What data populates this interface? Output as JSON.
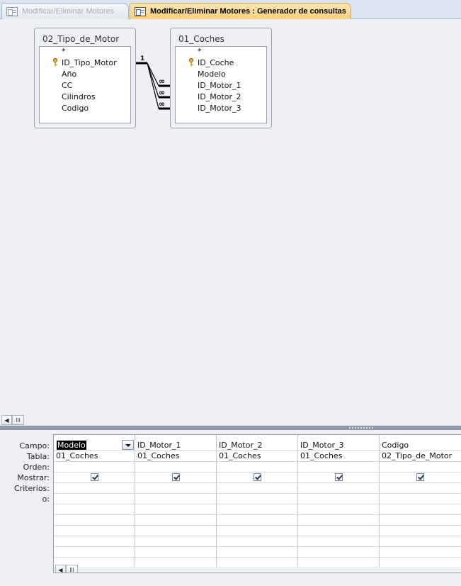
{
  "tabs": [
    {
      "label": "Modificar/Eliminar Motores",
      "state": "inactive"
    },
    {
      "label": "Modificar/Eliminar Motores : Generador de consultas",
      "state": "active"
    }
  ],
  "tables": [
    {
      "title": "02_Tipo_de_Motor",
      "fields": [
        "*",
        "ID_Tipo_Motor",
        "Año",
        "CC",
        "Cilindros",
        "Codigo"
      ],
      "key_field": "ID_Tipo_Motor"
    },
    {
      "title": "01_Coches",
      "fields": [
        "*",
        "ID_Coche",
        "Modelo",
        "ID_Motor_1",
        "ID_Motor_2",
        "ID_Motor_3"
      ],
      "key_field": "ID_Coche"
    }
  ],
  "relationship": {
    "one_label": "1",
    "many_label": "∞",
    "count": 3
  },
  "grid": {
    "row_labels": [
      "Campo:",
      "Tabla:",
      "Orden:",
      "Mostrar:",
      "Criterios:",
      "o:"
    ],
    "columns": [
      {
        "campo": "Modelo",
        "tabla": "01_Coches",
        "mostrar": true,
        "selected": true
      },
      {
        "campo": "ID_Motor_1",
        "tabla": "01_Coches",
        "mostrar": true
      },
      {
        "campo": "ID_Motor_2",
        "tabla": "01_Coches",
        "mostrar": true
      },
      {
        "campo": "ID_Motor_3",
        "tabla": "01_Coches",
        "mostrar": true
      },
      {
        "campo": "Codigo",
        "tabla": "02_Tipo_de_Motor",
        "mostrar": true
      }
    ]
  },
  "icons": {
    "tab_icon": "query-design-icon",
    "key": "primary-key-icon",
    "scroll_left": "scroll-left-arrow-icon",
    "thumb_grip": "grip-icon",
    "dropdown": "chevron-down-icon",
    "checkbox": "checkbox-checked-icon"
  },
  "colors": {
    "active_tab": "#f8cf7c",
    "inactive_tab_text": "#a8b0bc",
    "design_background": "#eef0f3",
    "splitter": "#8d97a5",
    "selection": "#000000"
  }
}
